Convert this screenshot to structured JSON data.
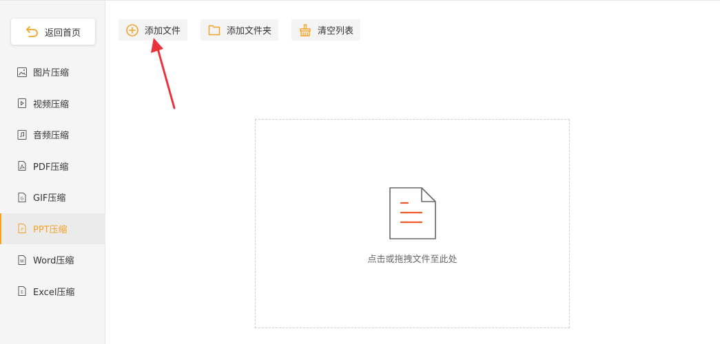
{
  "sidebar": {
    "back_label": "返回首页",
    "items": [
      {
        "label": "图片压缩",
        "icon": "image-file-icon"
      },
      {
        "label": "视频压缩",
        "icon": "video-file-icon"
      },
      {
        "label": "音频压缩",
        "icon": "audio-file-icon"
      },
      {
        "label": "PDF压缩",
        "icon": "pdf-file-icon"
      },
      {
        "label": "GIF压缩",
        "icon": "gif-file-icon"
      },
      {
        "label": "PPT压缩",
        "icon": "ppt-file-icon",
        "active": true
      },
      {
        "label": "Word压缩",
        "icon": "word-file-icon"
      },
      {
        "label": "Excel压缩",
        "icon": "excel-file-icon"
      }
    ]
  },
  "toolbar": {
    "add_file_label": "添加文件",
    "add_folder_label": "添加文件夹",
    "clear_list_label": "清空列表"
  },
  "dropzone": {
    "hint": "点击或拖拽文件至此处"
  },
  "colors": {
    "accent": "#f5a325",
    "doc_lines": "#f0582a",
    "annotation_arrow": "#e8323c"
  }
}
